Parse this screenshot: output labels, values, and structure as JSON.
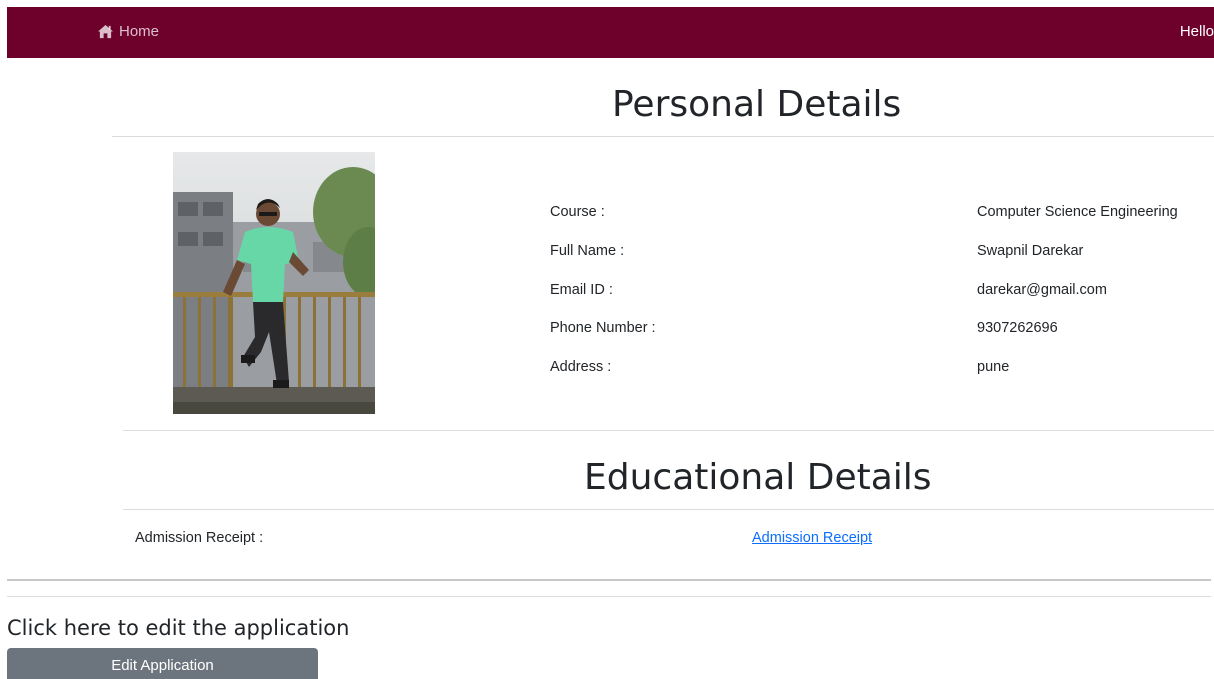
{
  "navbar": {
    "home_label": "Home",
    "greeting": "Hello",
    "background_color": "#6e002c"
  },
  "personal_details": {
    "title": "Personal Details",
    "photo_description": "profile-photo",
    "rows": [
      {
        "label": "Course :",
        "value": "Computer Science Engineering"
      },
      {
        "label": "Full Name :",
        "value": "Swapnil Darekar"
      },
      {
        "label": "Email ID :",
        "value": "darekar@gmail.com"
      },
      {
        "label": "Phone Number :",
        "value": "9307262696"
      },
      {
        "label": "Address :",
        "value": "pune"
      }
    ]
  },
  "educational_details": {
    "title": "Educational Details",
    "receipt_label": "Admission Receipt :",
    "receipt_link": "Admission Receipt",
    "link_color": "#0d6efd"
  },
  "edit": {
    "prompt": "Click here to edit the application",
    "button_label": "Edit Application",
    "button_color": "#6c757d"
  },
  "icons": {
    "home": "home-icon"
  }
}
